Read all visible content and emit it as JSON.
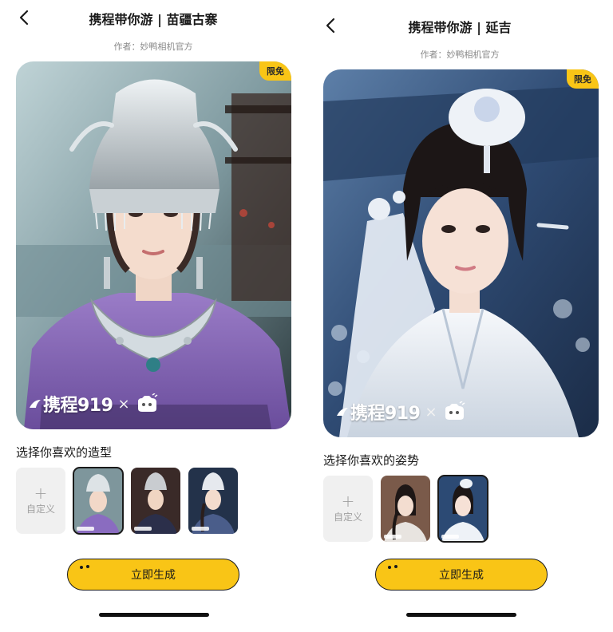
{
  "screens": [
    {
      "title": "携程带你游 | 苗疆古寨",
      "author": "作者：妙鸭相机官方",
      "badge": "限免",
      "brand_text": "携程919",
      "brand_x": "×",
      "section_label": "选择你喜欢的造型",
      "custom_tile": {
        "plus": "+",
        "label": "自定义"
      },
      "thumbnails": [
        {
          "style": "miao-purple",
          "selected": true
        },
        {
          "style": "miao-dark",
          "selected": false
        },
        {
          "style": "miao-braid",
          "selected": false
        }
      ],
      "generate_button": "立即生成"
    },
    {
      "title": "携程带你游 | 延吉",
      "author": "作者：妙鸭相机官方",
      "badge": "限免",
      "brand_text": "携程919",
      "brand_x": "×",
      "section_label": "选择你喜欢的姿势",
      "custom_tile": {
        "plus": "+",
        "label": "自定义"
      },
      "thumbnails": [
        {
          "style": "yanji-braid",
          "selected": false
        },
        {
          "style": "yanji-white",
          "selected": true
        }
      ],
      "generate_button": "立即生成"
    }
  ],
  "colors": {
    "accent": "#f9c516",
    "text_primary": "#1a1a1a",
    "text_secondary": "#8a8a8a",
    "tile_bg": "#f0f0f0"
  },
  "icons": [
    "back-arrow-icon",
    "plus-icon",
    "camera-logo-icon"
  ]
}
